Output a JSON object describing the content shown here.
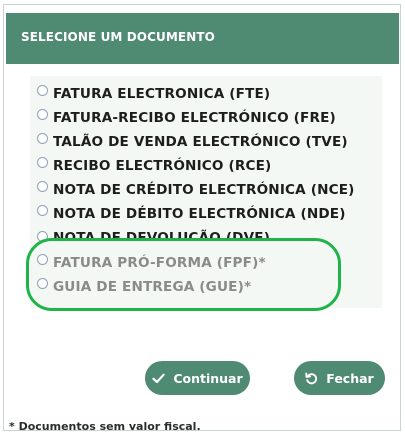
{
  "dialog": {
    "title": "SELECIONE UM DOCUMENTO"
  },
  "options": [
    {
      "label": "FATURA ELECTRONICA (FTE)",
      "disabled": false
    },
    {
      "label": "FATURA-RECIBO ELECTRÓNICO (FRE)",
      "disabled": false
    },
    {
      "label": "TALÃO DE VENDA ELECTRÓNICO (TVE)",
      "disabled": false
    },
    {
      "label": "RECIBO ELECTRÓNICO (RCE)",
      "disabled": false
    },
    {
      "label": "NOTA DE CRÉDITO ELECTRÓNICA (NCE)",
      "disabled": false
    },
    {
      "label": "NOTA DE DÉBITO ELECTRÓNICA (NDE)",
      "disabled": false
    },
    {
      "label": "NOTA DE DEVOLUÇÃO (DVE)",
      "disabled": false
    },
    {
      "label": "FATURA PRÓ-FORMA (FPF)*",
      "disabled": true
    },
    {
      "label": "GUIA DE ENTREGA (GUE)*",
      "disabled": true
    }
  ],
  "buttons": {
    "continuar": {
      "label": "Continuar",
      "icon": "check-icon"
    },
    "fechar": {
      "label": "Fechar",
      "icon": "undo-icon"
    }
  },
  "footnote": "* Documentos sem valor fiscal.",
  "colors": {
    "header": "#4f8a72",
    "button": "#4f8a72",
    "highlight": "#1fb34a",
    "panel": "#f3f8f5"
  }
}
